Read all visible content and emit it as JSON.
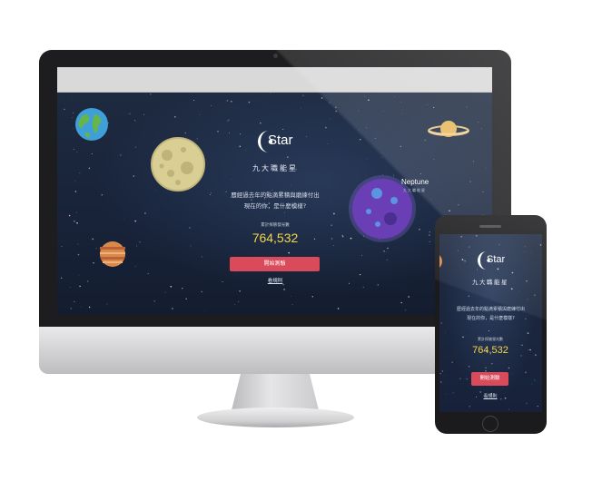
{
  "logo": {
    "word": "Star"
  },
  "tagline": "九大職能星",
  "description": {
    "line1": "歷經過去年的點滴累積與磨練付出",
    "line2": "現在的你，是什麼模樣?"
  },
  "counter": {
    "label": "累計探險發光數",
    "value": "764,532"
  },
  "start_button": "開始測驗",
  "bottom_link": "看規則",
  "planet_label": {
    "name": "Neptune",
    "sub": "九大職能星"
  },
  "colors": {
    "button": "#d94a5a",
    "counter": "#f4d64a",
    "background": "#1b2433"
  }
}
